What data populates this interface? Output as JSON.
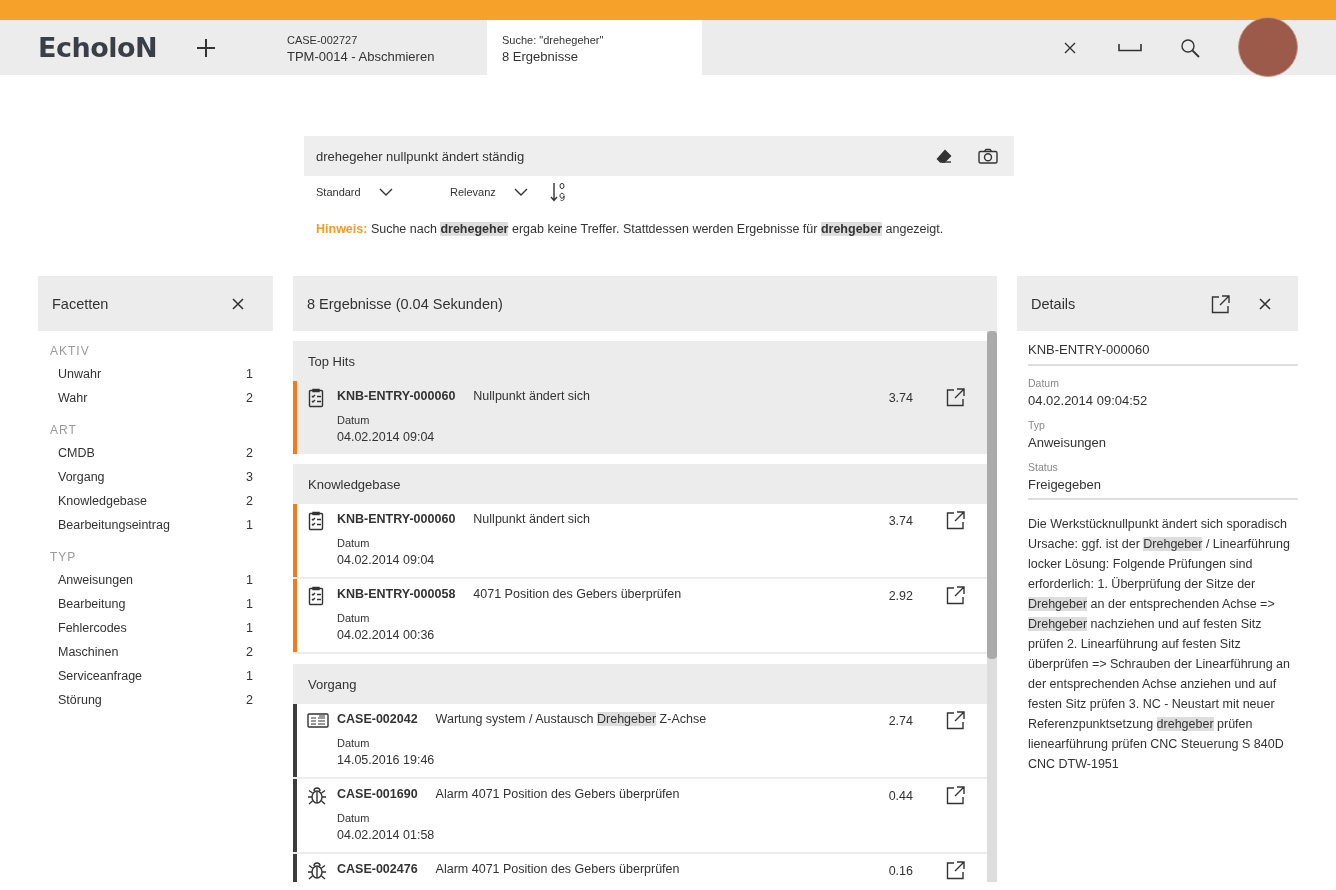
{
  "header": {
    "logo": "EcholoN",
    "tabs": [
      {
        "line1": "CASE-002727",
        "line2": "TPM-0014 - Abschmieren",
        "selected": false
      },
      {
        "line1": "Suche: \"drehegeher\"",
        "line2": "8 Ergebnisse",
        "selected": true
      }
    ]
  },
  "search": {
    "value": "drehegeher nullpunkt ändert ständig",
    "mode": "Standard",
    "sort": "Relevanz",
    "hint": {
      "label": "Hinweis:",
      "parts": [
        {
          "text": "Suche nach ",
          "highlight": false
        },
        {
          "text": "drehegeher",
          "highlight": true
        },
        {
          "text": " ergab keine Treffer. Stattdessen werden Ergebnisse für ",
          "highlight": false
        },
        {
          "text": "drehgeber",
          "highlight": true
        },
        {
          "text": " angezeigt.",
          "highlight": false
        }
      ]
    }
  },
  "facets": {
    "title": "Facetten",
    "sections": [
      {
        "title": "AKTIV",
        "items": [
          {
            "label": "Unwahr",
            "count": "1"
          },
          {
            "label": "Wahr",
            "count": "2"
          }
        ]
      },
      {
        "title": "ART",
        "items": [
          {
            "label": "CMDB",
            "count": "2"
          },
          {
            "label": "Vorgang",
            "count": "3"
          },
          {
            "label": "Knowledgebase",
            "count": "2"
          },
          {
            "label": "Bearbeitungseintrag",
            "count": "1"
          }
        ]
      },
      {
        "title": "TYP",
        "items": [
          {
            "label": "Anweisungen",
            "count": "1"
          },
          {
            "label": "Bearbeitung",
            "count": "1"
          },
          {
            "label": "Fehlercodes",
            "count": "1"
          },
          {
            "label": "Maschinen",
            "count": "2"
          },
          {
            "label": "Serviceanfrage",
            "count": "1"
          },
          {
            "label": "Störung",
            "count": "2"
          }
        ]
      }
    ]
  },
  "results": {
    "title": "8 Ergebnisse (0.04 Sekunden)",
    "groups": [
      {
        "title": "Top Hits",
        "shaded": true,
        "items": [
          {
            "kind": "checklist",
            "color": "#f07c1b",
            "id": "KNB-ENTRY-000060",
            "title": [
              {
                "text": "Nullpunkt ändert sich",
                "highlight": false
              }
            ],
            "date_label": "Datum",
            "date": "04.02.2014 09:04",
            "score": "3.74"
          }
        ]
      },
      {
        "title": "Knowledgebase",
        "shaded": false,
        "items": [
          {
            "kind": "checklist",
            "color": "#f07c1b",
            "id": "KNB-ENTRY-000060",
            "title": [
              {
                "text": "Nullpunkt ändert sich",
                "highlight": false
              }
            ],
            "date_label": "Datum",
            "date": "04.02.2014 09:04",
            "score": "3.74"
          },
          {
            "kind": "checklist",
            "color": "#f07c1b",
            "id": "KNB-ENTRY-000058",
            "title": [
              {
                "text": "4071 Position des Gebers überprüfen",
                "highlight": false
              }
            ],
            "date_label": "Datum",
            "date": "04.02.2014 00:36",
            "score": "2.92"
          }
        ]
      },
      {
        "title": "Vorgang",
        "shaded": false,
        "items": [
          {
            "kind": "list",
            "color": "#3c3c3c",
            "id": "CASE-002042",
            "title": [
              {
                "text": "Wartung system / Austausch ",
                "highlight": false
              },
              {
                "text": "Drehgeber",
                "highlight": true
              },
              {
                "text": " Z-Achse",
                "highlight": false
              }
            ],
            "date_label": "Datum",
            "date": "14.05.2016 19:46",
            "score": "2.74"
          },
          {
            "kind": "bug",
            "color": "#3c3c3c",
            "id": "CASE-001690",
            "title": [
              {
                "text": "Alarm 4071 Position des Gebers überprüfen",
                "highlight": false
              }
            ],
            "date_label": "Datum",
            "date": "04.02.2014 01:58",
            "score": "0.44"
          },
          {
            "kind": "bug",
            "color": "#3c3c3c",
            "id": "CASE-002476",
            "title": [
              {
                "text": "Alarm 4071 Position des Gebers überprüfen",
                "highlight": false
              }
            ],
            "score": "0.16"
          }
        ]
      }
    ]
  },
  "details": {
    "title": "Details",
    "id": "KNB-ENTRY-000060",
    "fields": [
      {
        "label": "Datum",
        "value": "04.02.2014 09:04:52"
      },
      {
        "label": "Typ",
        "value": "Anweisungen"
      },
      {
        "label": "Status",
        "value": "Freigegeben"
      }
    ],
    "body": [
      {
        "text": "Die Werkstücknullpunkt ändert sich sporadisch Ursache: ggf. ist der ",
        "highlight": false
      },
      {
        "text": "Drehgeber",
        "highlight": true
      },
      {
        "text": " / Linearführung locker Lösung: Folgende Prüfungen sind erforderlich: 1. Überprüfung der Sitze der ",
        "highlight": false
      },
      {
        "text": "Drehgeber",
        "highlight": true
      },
      {
        "text": " an der entsprechenden Achse => ",
        "highlight": false
      },
      {
        "text": "Drehgeber",
        "highlight": true
      },
      {
        "text": " nachziehen und auf festen Sitz prüfen 2. Linearführung auf festen Sitz überprüfen => Schrauben der Linearführung an der entsprechenden Achse anziehen und auf festen Sitz prüfen 3. NC - Neustart mit neuer Referenzpunktsetzung ",
        "highlight": false
      },
      {
        "text": "drehgeber",
        "highlight": true
      },
      {
        "text": " prüfen lienearführung prüfen CNC Steuerung S 840D CNC DTW-1951",
        "highlight": false
      }
    ]
  }
}
